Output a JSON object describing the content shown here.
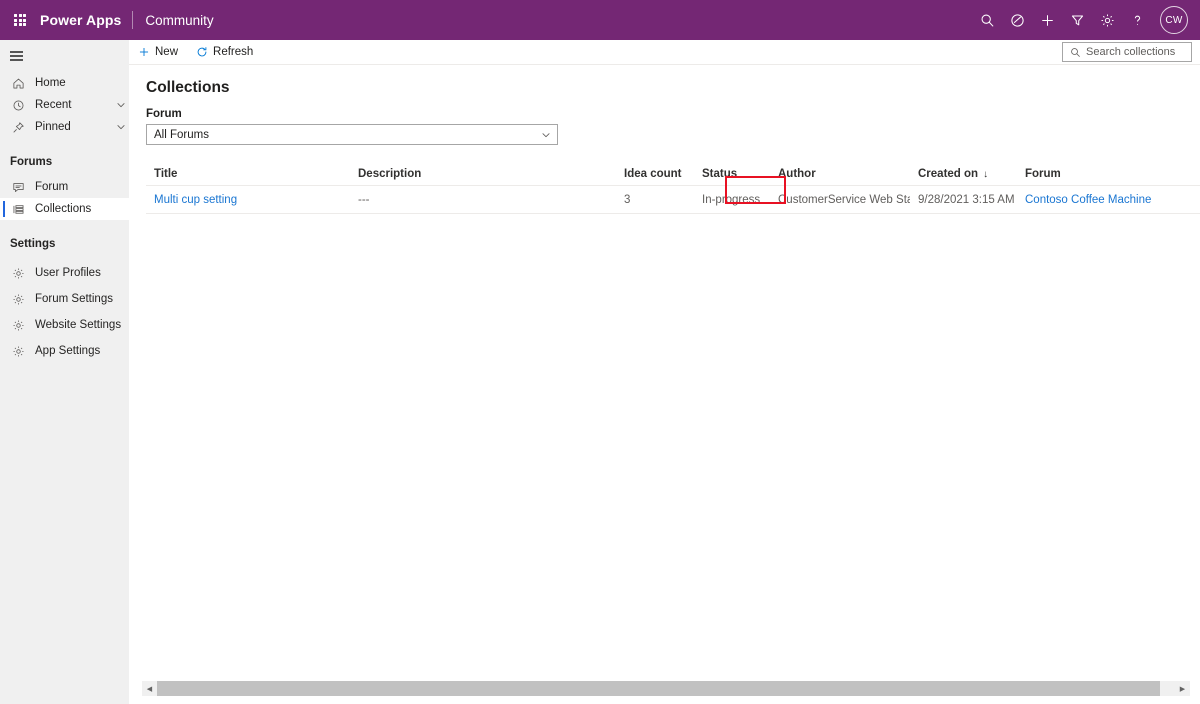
{
  "header": {
    "waffle_label": "app-launcher",
    "brand": "Power Apps",
    "subbrand": "Community",
    "actions": [
      {
        "name": "search-icon",
        "label": "Search"
      },
      {
        "name": "environment-icon",
        "label": "Environment"
      },
      {
        "name": "plus-icon",
        "label": "New"
      },
      {
        "name": "filter-icon",
        "label": "Filter"
      },
      {
        "name": "gear-icon",
        "label": "Settings"
      },
      {
        "name": "help-icon",
        "label": "Help"
      }
    ],
    "avatar_initials": "CW",
    "background_color": "#742774"
  },
  "sidebar": {
    "items": [
      {
        "label": "Home",
        "icon": "home-icon",
        "expandable": false,
        "selected": false
      },
      {
        "label": "Recent",
        "icon": "clock-icon",
        "expandable": true,
        "selected": false
      },
      {
        "label": "Pinned",
        "icon": "pin-icon",
        "expandable": true,
        "selected": false
      }
    ],
    "groups": [
      {
        "title": "Forums",
        "items": [
          {
            "label": "Forum",
            "icon": "comment-icon",
            "selected": false
          },
          {
            "label": "Collections",
            "icon": "list-icon",
            "selected": true
          }
        ]
      },
      {
        "title": "Settings",
        "items": [
          {
            "label": "User Profiles",
            "icon": "gear-icon",
            "selected": false
          },
          {
            "label": "Forum Settings",
            "icon": "gear-icon",
            "selected": false
          },
          {
            "label": "Website Settings",
            "icon": "gear-icon",
            "selected": false
          },
          {
            "label": "App Settings",
            "icon": "gear-icon",
            "selected": false
          }
        ]
      }
    ],
    "selected_accent_color": "#2266dd"
  },
  "commandbar": {
    "new_label": "New",
    "refresh_label": "Refresh",
    "search_placeholder": "Search collections",
    "accent_color": "#0078d4"
  },
  "main": {
    "title": "Collections",
    "filter": {
      "label": "Forum",
      "value": "All Forums"
    },
    "table": {
      "columns": [
        {
          "key": "title",
          "label": "Title"
        },
        {
          "key": "description",
          "label": "Description"
        },
        {
          "key": "idea_count",
          "label": "Idea count"
        },
        {
          "key": "status",
          "label": "Status"
        },
        {
          "key": "author",
          "label": "Author"
        },
        {
          "key": "created_on",
          "label": "Created on",
          "sorted": true,
          "sort_direction": "descending",
          "sort_glyph": "↓"
        },
        {
          "key": "forum",
          "label": "Forum"
        }
      ],
      "rows": [
        {
          "title": "Multi cup setting",
          "description": "---",
          "idea_count": "3",
          "status": "In-progress",
          "author": "CustomerService Web Staging",
          "created_on": "9/28/2021 3:15 AM",
          "forum": "Contoso Coffee Machine"
        }
      ]
    }
  },
  "annotation": {
    "target": "status-cell",
    "color": "#e81123"
  },
  "scrollbar": {
    "left_arrow": "◀",
    "right_arrow": "▶"
  }
}
